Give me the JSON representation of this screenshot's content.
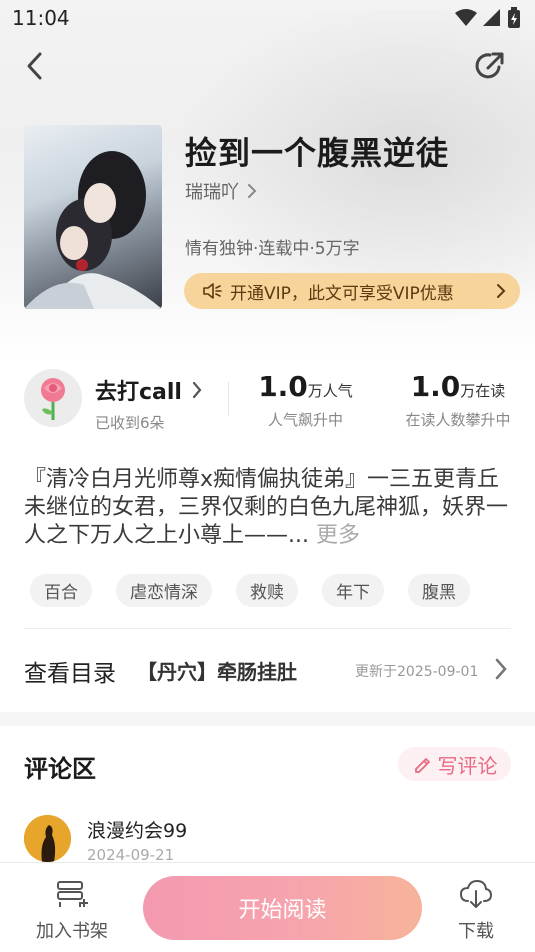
{
  "status_bar": {
    "time": "11:04"
  },
  "book": {
    "title": "捡到一个腹黑逆徒",
    "author": "瑞瑞吖",
    "meta": "情有独钟·连载中·5万字",
    "vip_banner": "开通VIP，此文可享受VIP优惠"
  },
  "stats": {
    "call_title": "去打call",
    "call_sub": "已收到6朵",
    "popularity": {
      "value": "1.0",
      "unit": "万人气",
      "sub": "人气飙升中"
    },
    "reading": {
      "value": "1.0",
      "unit": "万在读",
      "sub": "在读人数攀升中"
    }
  },
  "synopsis": {
    "text": "『清冷白月光师尊x痴情偏执徒弟』一三五更青丘未继位的女君，三界仅剩的白色九尾神狐，妖界一人之下万人之上小尊上——...",
    "more": "更多"
  },
  "tags": [
    "百合",
    "虐恋情深",
    "救赎",
    "年下",
    "腹黑"
  ],
  "catalog": {
    "label": "查看目录",
    "latest_chapter": "【丹穴】牵肠挂肚",
    "updated": "更新于2025-09-01"
  },
  "comments": {
    "title": "评论区",
    "write_label": "写评论",
    "items": [
      {
        "user": "浪漫约会99",
        "date": "2024-09-21"
      }
    ]
  },
  "bottom_bar": {
    "shelf_label": "加入书架",
    "read_label": "开始阅读",
    "download_label": "下载"
  },
  "colors": {
    "vip_banner": "#f7d49a",
    "accent_pink": "#e86a84",
    "read_button_start": "#f49ab0",
    "read_button_end": "#f7b39a"
  },
  "icons": {
    "back": "back-arrow-icon",
    "share": "share-icon",
    "speaker": "speaker-icon",
    "rose": "rose-icon",
    "pen": "pen-icon",
    "bookshelf": "bookshelf-add-icon",
    "download": "cloud-download-icon"
  }
}
